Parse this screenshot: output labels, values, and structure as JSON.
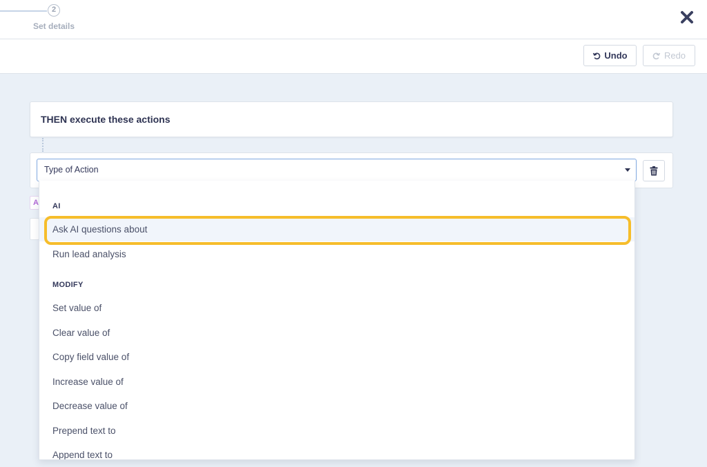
{
  "stepper": {
    "step_number": "2",
    "step_label": "Set details"
  },
  "toolbar": {
    "undo_label": "Undo",
    "redo_label": "Redo"
  },
  "then_card": {
    "title": "THEN execute these actions"
  },
  "action": {
    "select_placeholder": "Type of Action"
  },
  "ghost": {
    "tag_letter": "A"
  },
  "dropdown": {
    "groups": [
      {
        "header": "AI",
        "items": [
          "Ask AI questions about",
          "Run lead analysis"
        ]
      },
      {
        "header": "MODIFY",
        "items": [
          "Set value of",
          "Clear value of",
          "Copy field value of",
          "Increase value of",
          "Decrease value of",
          "Prepend text to",
          "Append text to"
        ]
      }
    ],
    "highlighted_item": "Ask AI questions about"
  },
  "colors": {
    "background": "#eaf0f7",
    "highlight_ring": "#f6bd2b",
    "select_border": "#7ea7df",
    "text_dark": "#2e3352"
  },
  "icons": [
    "close-icon",
    "undo-icon",
    "redo-icon",
    "trash-icon",
    "caret-down-icon"
  ]
}
